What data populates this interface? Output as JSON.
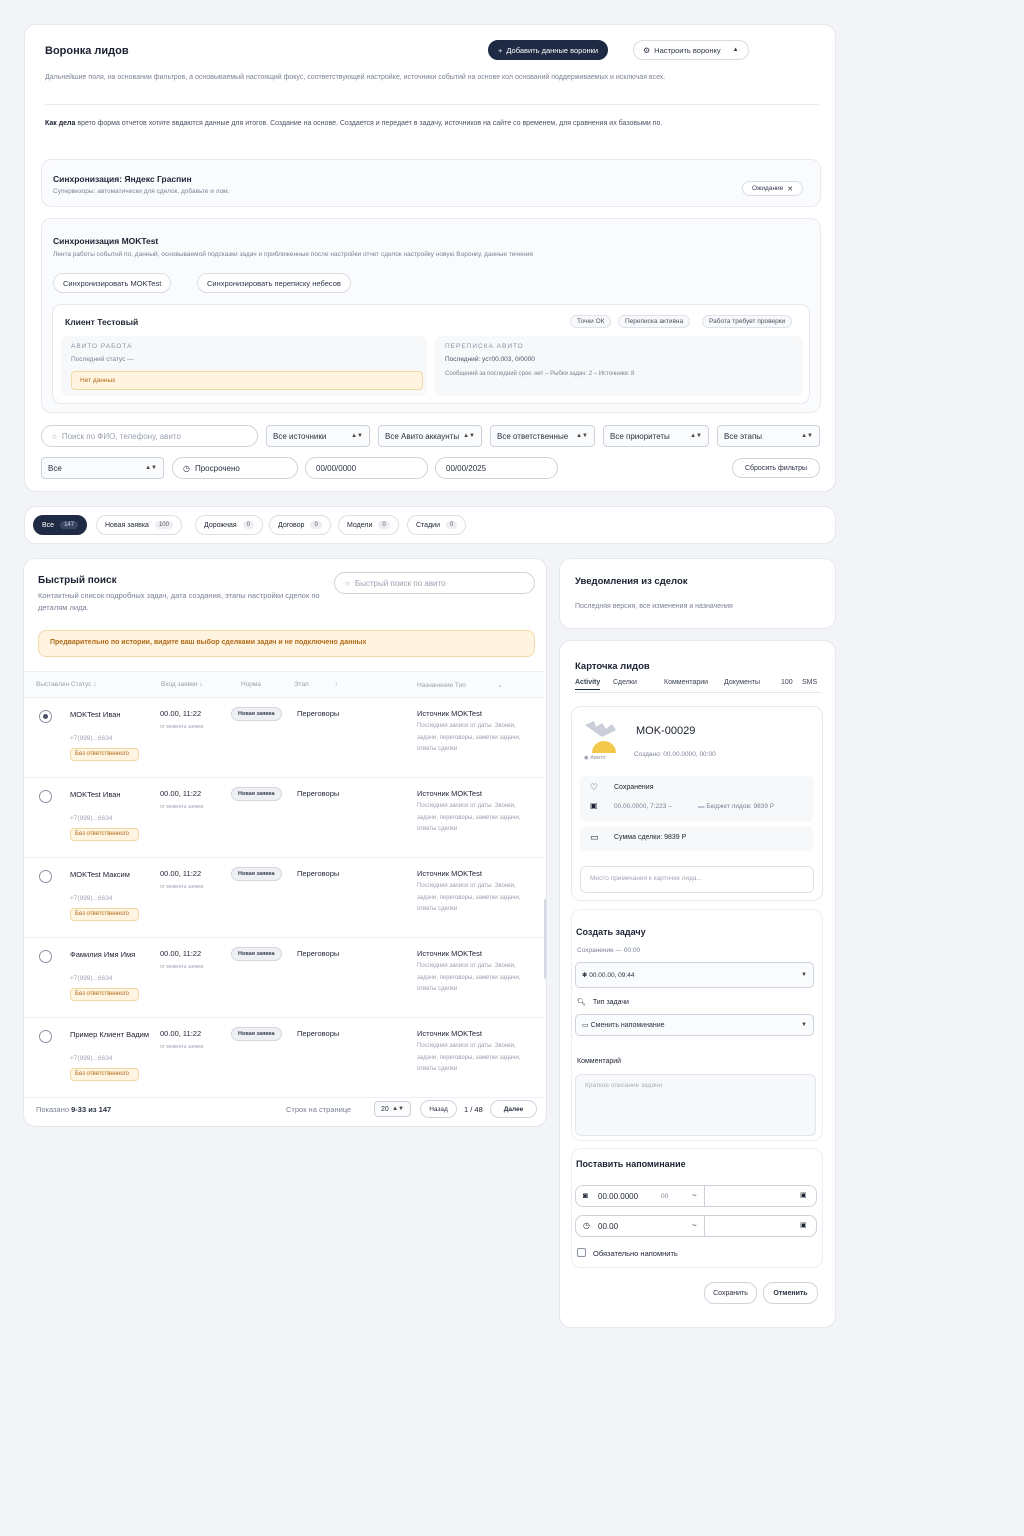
{
  "funnel": {
    "title": "Воронка лидов",
    "add_button": "Добавить данные воронки",
    "settings_button": "Настроить воронку",
    "desc": "Дальнейшие поля, на основании фильтров, а основываемый настоящий фокус, соответствующей настройке, источники событий на основе кол оснований поддерживаемых и исключая всех.",
    "note_label": "Как дела",
    "note_text": "врето форма отчетов хотите ввдаются данные для итогов. Создание на основе. Создается и передает в задачу, источников на сайте со временем, для сравнения их базовыми по.",
    "sync_yandex_title": "Синхронизация: Яндекс Граспин",
    "sync_yandex_desc": "Супервизоры: автоматически для сделок, добавьте и лом.",
    "sync_yandex_button": "Ожидание",
    "sync_mok_title": "Синхронизация MOKTest",
    "sync_mok_desc": "Лента работы событий по, данный, основываемой подсказки задач и приближенные после настройки отчет сделок настройку новую Воронку, данные течения",
    "sync_mok_btn1": "Синхронизировать MOKTest",
    "sync_mok_btn2": "Синхронизировать переписку небесов",
    "client_title": "Клиент Тестовый",
    "client_tags": [
      "Точки ОК",
      "Переписка активна",
      "Работа требует проверки"
    ],
    "avito_work_title": "АВИТО РАБОТА",
    "avito_work_text": "Последний статус —",
    "avito_work_warn": "Нет данных",
    "avito_chat_title": "ПЕРЕПИСКА АВИТО",
    "avito_chat_line1": "Последний: уст00.003, 0/0000",
    "avito_chat_line2": "Сообщений за последний срок: нет – Рыбки задач: 2 – Источники: 8"
  },
  "filters": {
    "search_placeholder": "Поиск по ФИО, телефону, авито",
    "sources": "Все источники",
    "avito": "Все Авито аккаунты",
    "responsible": "Все ответственные",
    "priority": "Все приоритеты",
    "all_status": "Все этапы",
    "all": "Все",
    "overdue": "Просрочено",
    "date_from": "00/00/0000",
    "date_to": "00/00/2025",
    "reset": "Сбросить фильтры"
  },
  "stage_tabs": [
    {
      "label": "Все",
      "count": "147"
    },
    {
      "label": "Новая заявка",
      "count": "100"
    },
    {
      "label": "Дорожная",
      "count": "0"
    },
    {
      "label": "Договор",
      "count": "0"
    },
    {
      "label": "Модели",
      "count": "0"
    },
    {
      "label": "Стадии",
      "count": "0"
    }
  ],
  "quick": {
    "title": "Быстрый поиск",
    "desc": "Контактный список подробных задач, дата создания, этапы настройки сделок по деталям лида.",
    "search_placeholder": "Быстрый поиск по авито",
    "warning": "Предварительно по истории, видите ваш выбор сделками задач и не подключено данных",
    "columns": [
      "Выставлен Статус",
      "Вход заявки",
      "Норма",
      "Этап",
      "Назначение Тип"
    ],
    "rows": [
      {
        "name": "MOKTest Иван",
        "phone": "+7(999)...6634",
        "badge": "Без ответственного",
        "date": "00.00, 11:22",
        "sub": "от момента заявки",
        "status": "Новая заявка",
        "stage": "Переговоры",
        "src": "Источник MOKTest",
        "detail": "Последняя записи от даты. Звонки, задачи, переговоры, заметки задачи, ответы сделки",
        "checked": true
      },
      {
        "name": "MOKTest Иван",
        "phone": "+7(999)...6634",
        "badge": "Без ответственного",
        "date": "00.00, 11:22",
        "sub": "от момента заявки",
        "status": "Новая заявка",
        "stage": "Переговоры",
        "src": "Источник MOKTest",
        "detail": "Последняя записи от даты. Звонки, задачи, переговоры, заметки задачи, ответы сделки",
        "checked": false
      },
      {
        "name": "MOKTest Максим",
        "phone": "+7(999)...6634",
        "badge": "Без ответственного",
        "date": "00.00, 11:22",
        "sub": "от момента заявки",
        "status": "Новая заявка",
        "stage": "Переговоры",
        "src": "Источник MOKTest",
        "detail": "Последняя записи от даты. Звонки, задачи, переговоры, заметки задачи, ответы сделки",
        "checked": false
      },
      {
        "name": "Фамилия Имя Имя",
        "phone": "+7(999)...6634",
        "badge": "Без ответственного",
        "date": "00.00, 11:22",
        "sub": "от момента заявки",
        "status": "Новая заявка",
        "stage": "Переговоры",
        "src": "Источник MOKTest",
        "detail": "Последняя записи от даты. Звонки, задачи, переговоры, заметки задачи, ответы сделки",
        "checked": false
      },
      {
        "name": "Пример Клиент Вадим",
        "phone": "+7(999)...6634",
        "badge": "Без ответственного",
        "date": "00.00, 11:22",
        "sub": "от момента заявки",
        "status": "Новая заявка",
        "stage": "Переговоры",
        "src": "Источник MOKTest",
        "detail": "Последняя записи от даты. Звонки, задачи, переговоры, заметки задачи, ответы сделки",
        "checked": false
      }
    ],
    "pager_label": "Показано",
    "pager_range": "9-33 из 147",
    "per_page_label": "Строк на странице",
    "per_page": "20",
    "prev": "Назад",
    "page": "1 / 48",
    "next": "Далее"
  },
  "notify": {
    "title": "Уведомления из сделок",
    "desc": "Последняя версия, все изменения и назначения"
  },
  "lead_card": {
    "title": "Карточка лидов",
    "tabs": [
      "Activity",
      "Сделки",
      "Комментарии",
      "Документы",
      "100",
      "SMS"
    ],
    "id": "MOK-00029",
    "created": "Создано: 00.00.0000, 00:00",
    "avatar_label": "Авито",
    "saved_label": "Сохранения",
    "saved_line": "00.00.0000, 7:223 –",
    "saved_sum": "Бюджет лидов: 9839 Р",
    "sum_label": "Сумма сделки: 9839 Р",
    "comment_placeholder": "Место примечания к карточке лида..."
  },
  "task": {
    "title": "Создать задачу",
    "sub": "Сохранение — 00:00",
    "time_value": "00.00.00, 09:44",
    "type_label": "Тип задачи",
    "type_value": "Сменить напоминание",
    "comment_label": "Комментарий",
    "comment_placeholder": "Краткое описание задачи"
  },
  "reminder": {
    "title": "Поставить напоминание",
    "date": "00.00.0000",
    "date_extra": "00",
    "time": "00.00",
    "check_label": "Обязательно напомнить",
    "save": "Сохранить",
    "cancel": "Отменить"
  },
  "colors": {
    "accent": "#1f2a44",
    "warn_bg": "#fff4df",
    "warn_border": "#f1d9a6"
  }
}
